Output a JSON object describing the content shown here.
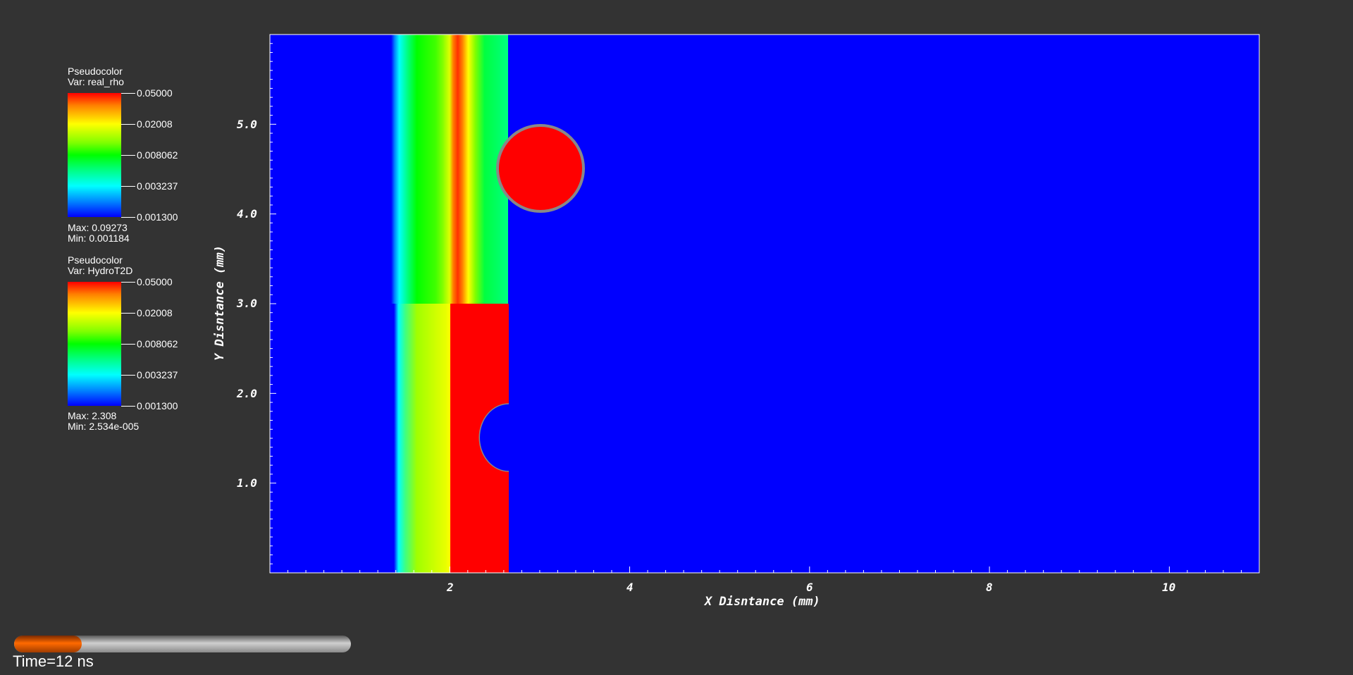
{
  "legends": [
    {
      "title": "Pseudocolor",
      "var": "Var: real_rho",
      "ticks": [
        "0.05000",
        "0.02008",
        "0.008062",
        "0.003237",
        "0.001300"
      ],
      "max": "Max:  0.09273",
      "min": "Min:  0.001184"
    },
    {
      "title": "Pseudocolor",
      "var": "Var: HydroT2D",
      "ticks": [
        "0.05000",
        "0.02008",
        "0.008062",
        "0.003237",
        "0.001300"
      ],
      "max": "Max:  2.308",
      "min": "Min:  2.534e-005"
    }
  ],
  "plot": {
    "xlabel": "X Disntance (mm)",
    "ylabel": "Y Disntance (mm)",
    "xlim": [
      0,
      11
    ],
    "ylim": [
      0,
      6
    ],
    "xticks": [
      "2",
      "4",
      "6",
      "8",
      "10"
    ],
    "yticks": [
      "1.0",
      "2.0",
      "3.0",
      "4.0",
      "5.0"
    ],
    "background_color": "#0000ff"
  },
  "time": {
    "label": "Time=12 ns",
    "progress": 0.2
  }
}
